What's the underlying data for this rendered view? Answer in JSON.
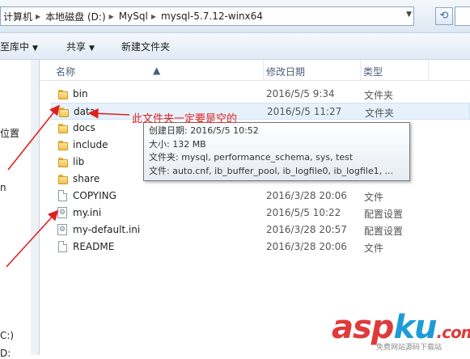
{
  "address_bar": {
    "crumbs": [
      "计算机",
      "本地磁盘 (D:)",
      "MySql",
      "mysql-5.7.12-winx64"
    ]
  },
  "toolbar": {
    "include_in_library": "至库中",
    "share": "共享",
    "new_folder": "新建文件夹"
  },
  "nav_pane": {
    "items": [
      "位置",
      "n",
      "C:)",
      "D:"
    ]
  },
  "columns": {
    "name": "名称",
    "date": "修改日期",
    "type": "类型"
  },
  "files": [
    {
      "name": "bin",
      "date": "2016/5/5 9:34",
      "type": "文件夹",
      "icon": "folder-icon"
    },
    {
      "name": "data",
      "date": "2016/5/5 11:27",
      "type": "文件夹",
      "icon": "folder-icon"
    },
    {
      "name": "docs",
      "date": "",
      "type": "",
      "icon": "folder-icon"
    },
    {
      "name": "include",
      "date": "",
      "type": "",
      "icon": "folder-icon"
    },
    {
      "name": "lib",
      "date": "",
      "type": "",
      "icon": "folder-icon"
    },
    {
      "name": "share",
      "date": "",
      "type": "",
      "icon": "folder-icon"
    },
    {
      "name": "COPYING",
      "date": "2016/3/28 20:06",
      "type": "文件",
      "icon": "document-icon"
    },
    {
      "name": "my.ini",
      "date": "2016/5/5 10:22",
      "type": "配置设置",
      "icon": "config-file-icon"
    },
    {
      "name": "my-default.ini",
      "date": "2016/3/28 20:57",
      "type": "配置设置",
      "icon": "config-file-icon"
    },
    {
      "name": "README",
      "date": "2016/3/28 20:06",
      "type": "文件",
      "icon": "document-icon"
    }
  ],
  "tooltip": {
    "created": "创建日期: 2016/5/5 10:52",
    "size": "大小: 132 MB",
    "folders": "文件夹: mysql, performance_schema, sys, test",
    "files": "文件: auto.cnf, ib_buffer_pool, ib_logfile0, ib_logfile1, ..."
  },
  "annotation": {
    "text": "此文件夹一定要是空的",
    "color": "#e02020"
  },
  "watermark": {
    "part1": "asp",
    "part2": "ku",
    "part3": ".com",
    "subtitle": "免费网站源码下载站"
  }
}
